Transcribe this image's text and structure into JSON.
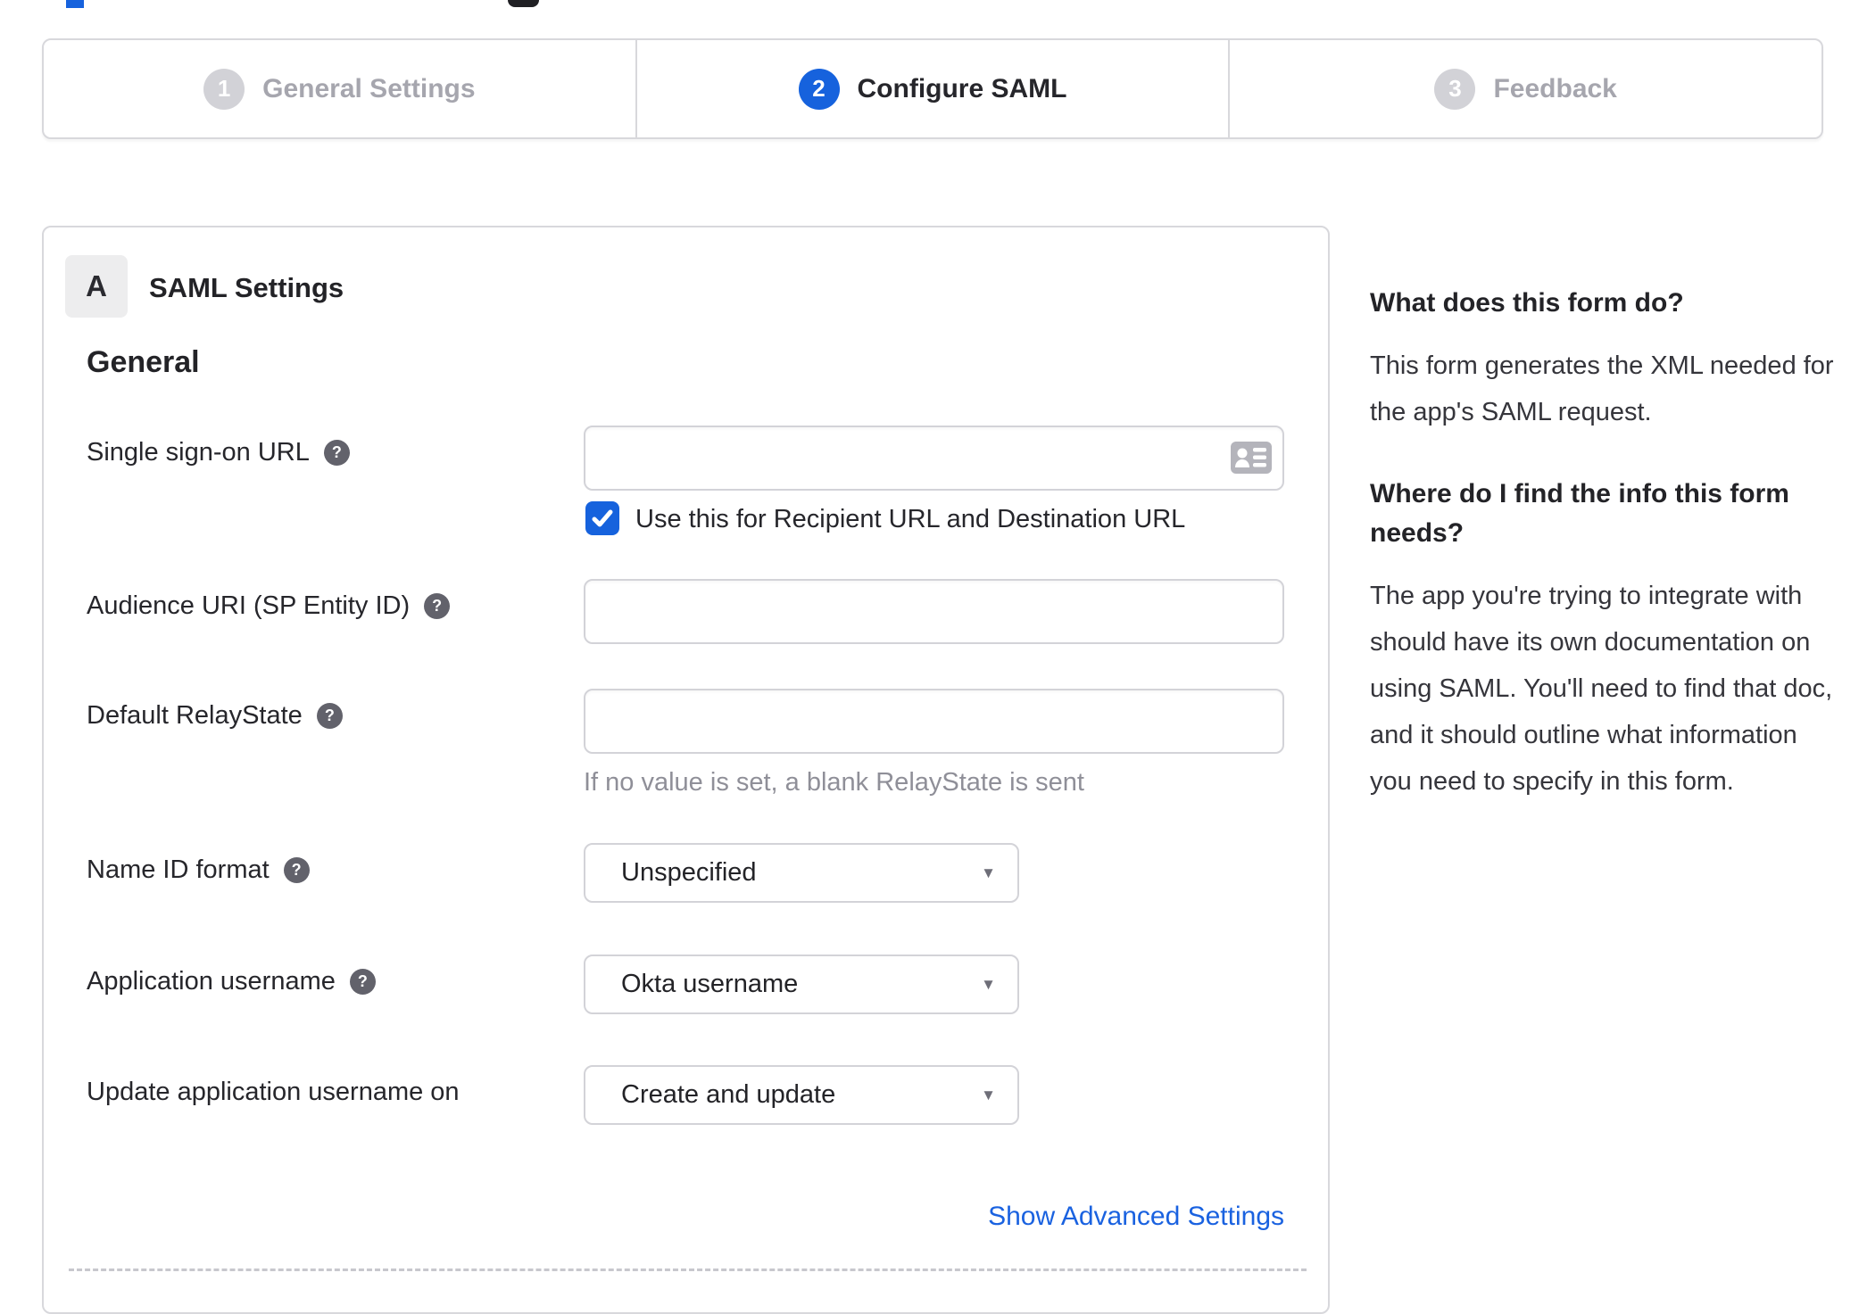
{
  "stepper": {
    "steps": [
      {
        "number": "1",
        "label": "General Settings",
        "state": "inactive"
      },
      {
        "number": "2",
        "label": "Configure SAML",
        "state": "active"
      },
      {
        "number": "3",
        "label": "Feedback",
        "state": "inactive"
      }
    ]
  },
  "panel": {
    "badge": "A",
    "title": "SAML Settings",
    "section_heading": "General",
    "fields": {
      "sso": {
        "label": "Single sign-on URL",
        "value": "",
        "checkbox_label": "Use this for Recipient URL and Destination URL",
        "checked": true
      },
      "audience": {
        "label": "Audience URI (SP Entity ID)",
        "value": ""
      },
      "relay": {
        "label": "Default RelayState",
        "value": "",
        "hint": "If no value is set, a blank RelayState is sent"
      },
      "name_id": {
        "label": "Name ID format",
        "value": "Unspecified"
      },
      "app_username": {
        "label": "Application username",
        "value": "Okta username"
      },
      "update_username": {
        "label": "Update application username on",
        "value": "Create and update"
      }
    },
    "advanced_link": "Show Advanced Settings"
  },
  "sidebar": {
    "sections": [
      {
        "heading": "What does this form do?",
        "body": "This form generates the XML needed for the app's SAML request."
      },
      {
        "heading": "Where do I find the info this form needs?",
        "body": "The app you're trying to integrate with should have its own documentation on using SAML. You'll need to find that doc, and it should outline what information you need to specify in this form."
      }
    ]
  },
  "ui": {
    "help_glyph": "?",
    "caret_glyph": "▼",
    "colors": {
      "accent_blue": "#1662dd",
      "link_blue": "#1a62e0",
      "inactive_gray": "#d2d2d7",
      "border_gray": "#d8d8dc",
      "muted_text": "#8f8f98"
    }
  }
}
